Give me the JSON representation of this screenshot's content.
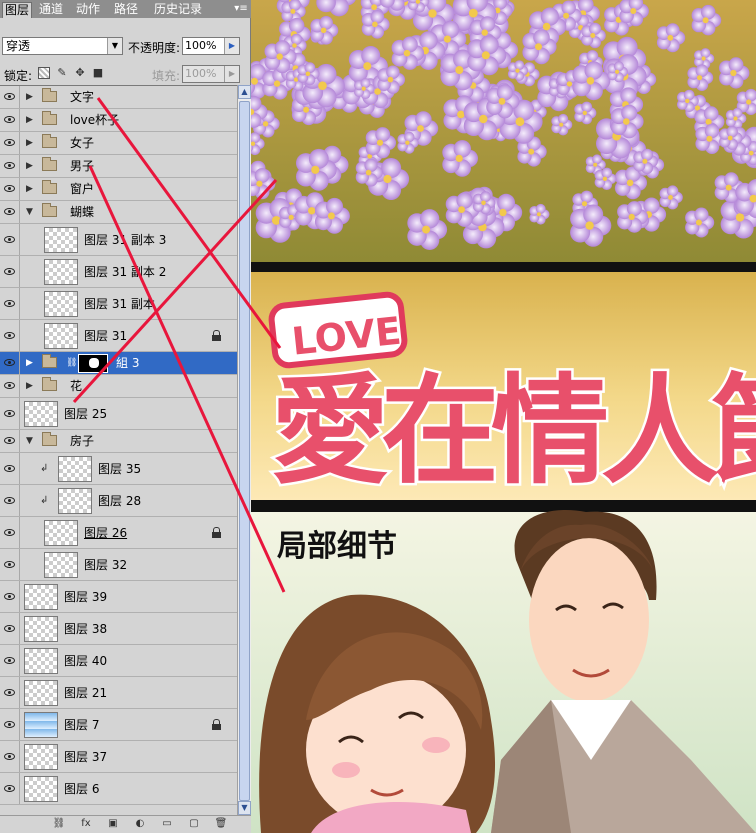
{
  "panel": {
    "tabs": [
      {
        "label": "图层",
        "active": true
      },
      {
        "label": "通道",
        "active": false
      },
      {
        "label": "动作",
        "active": false
      },
      {
        "label": "路径",
        "active": false
      },
      {
        "label": "历史记录",
        "active": false
      }
    ],
    "menu_icon": "panel-menu-icon",
    "blend_mode": "穿透",
    "opacity_label": "不透明度:",
    "opacity_value": "100%",
    "lock_label": "锁定:",
    "fill_label": "填充:",
    "fill_value": "100%",
    "lock_icons": [
      "lock-transparent-icon",
      "lock-paint-icon",
      "lock-move-icon",
      "lock-all-icon"
    ],
    "bottom_icons": [
      "link-icon",
      "fx-icon",
      "mask-icon",
      "adjustment-icon",
      "new-group-icon",
      "new-layer-icon",
      "trash-icon"
    ],
    "bottom_glyphs": [
      "⛓",
      "fx",
      "▣",
      "◐",
      "▭",
      "▢",
      "🗑"
    ]
  },
  "layers": [
    {
      "name": "文字",
      "kind": "group",
      "expanded": false,
      "level": 0,
      "visible": true
    },
    {
      "name": "love杯子",
      "kind": "group",
      "expanded": false,
      "level": 0,
      "visible": true
    },
    {
      "name": "女子",
      "kind": "group",
      "expanded": false,
      "level": 0,
      "visible": true
    },
    {
      "name": "男子",
      "kind": "group",
      "expanded": false,
      "level": 0,
      "visible": true
    },
    {
      "name": "窗户",
      "kind": "group",
      "expanded": false,
      "level": 0,
      "visible": true
    },
    {
      "name": "蝴蝶",
      "kind": "group",
      "expanded": true,
      "level": 0,
      "visible": true
    },
    {
      "name": "图层 31 副本 3",
      "kind": "layer",
      "level": 1,
      "visible": true
    },
    {
      "name": "图层 31 副本 2",
      "kind": "layer",
      "level": 1,
      "visible": true
    },
    {
      "name": "图层 31 副本",
      "kind": "layer",
      "level": 1,
      "visible": true
    },
    {
      "name": "图层 31",
      "kind": "layer",
      "level": 1,
      "visible": true,
      "locked": true
    },
    {
      "name": "組 3",
      "kind": "group-mask",
      "expanded": false,
      "level": 0,
      "visible": true,
      "selected": true
    },
    {
      "name": "花",
      "kind": "group",
      "expanded": false,
      "level": 0,
      "visible": true
    },
    {
      "name": "图层 25",
      "kind": "layer",
      "level": 0,
      "visible": true
    },
    {
      "name": "房子",
      "kind": "group",
      "expanded": true,
      "level": 0,
      "visible": true
    },
    {
      "name": "图层 35",
      "kind": "layer",
      "level": 1,
      "visible": true,
      "clipped": true
    },
    {
      "name": "图层 28",
      "kind": "layer",
      "level": 1,
      "visible": true,
      "clipped": true
    },
    {
      "name": "图层 26",
      "kind": "layer",
      "level": 1,
      "visible": true,
      "locked": true
    },
    {
      "name": "图层 32",
      "kind": "layer",
      "level": 1,
      "visible": true
    },
    {
      "name": "图层 39",
      "kind": "layer",
      "level": 0,
      "visible": true
    },
    {
      "name": "图层 38",
      "kind": "layer",
      "level": 0,
      "visible": true
    },
    {
      "name": "图层 40",
      "kind": "layer",
      "level": 0,
      "visible": true
    },
    {
      "name": "图层 21",
      "kind": "layer",
      "level": 0,
      "visible": true
    },
    {
      "name": "图层 7",
      "kind": "layer",
      "level": 0,
      "visible": true,
      "locked": true
    },
    {
      "name": "图层 37",
      "kind": "layer",
      "level": 0,
      "visible": true
    },
    {
      "name": "图层 6",
      "kind": "layer",
      "level": 0,
      "visible": true
    }
  ],
  "artwork": {
    "love_word": "LOVE",
    "title_chars": "愛在情人節",
    "detail_caption": "局部细节"
  },
  "colors": {
    "selection": "#316ac5",
    "annotation_line": "#e8163c",
    "panel_bg": "#d4d4d4",
    "tab_bar": "#8e8e8e",
    "title_pink": "#e8506b"
  }
}
